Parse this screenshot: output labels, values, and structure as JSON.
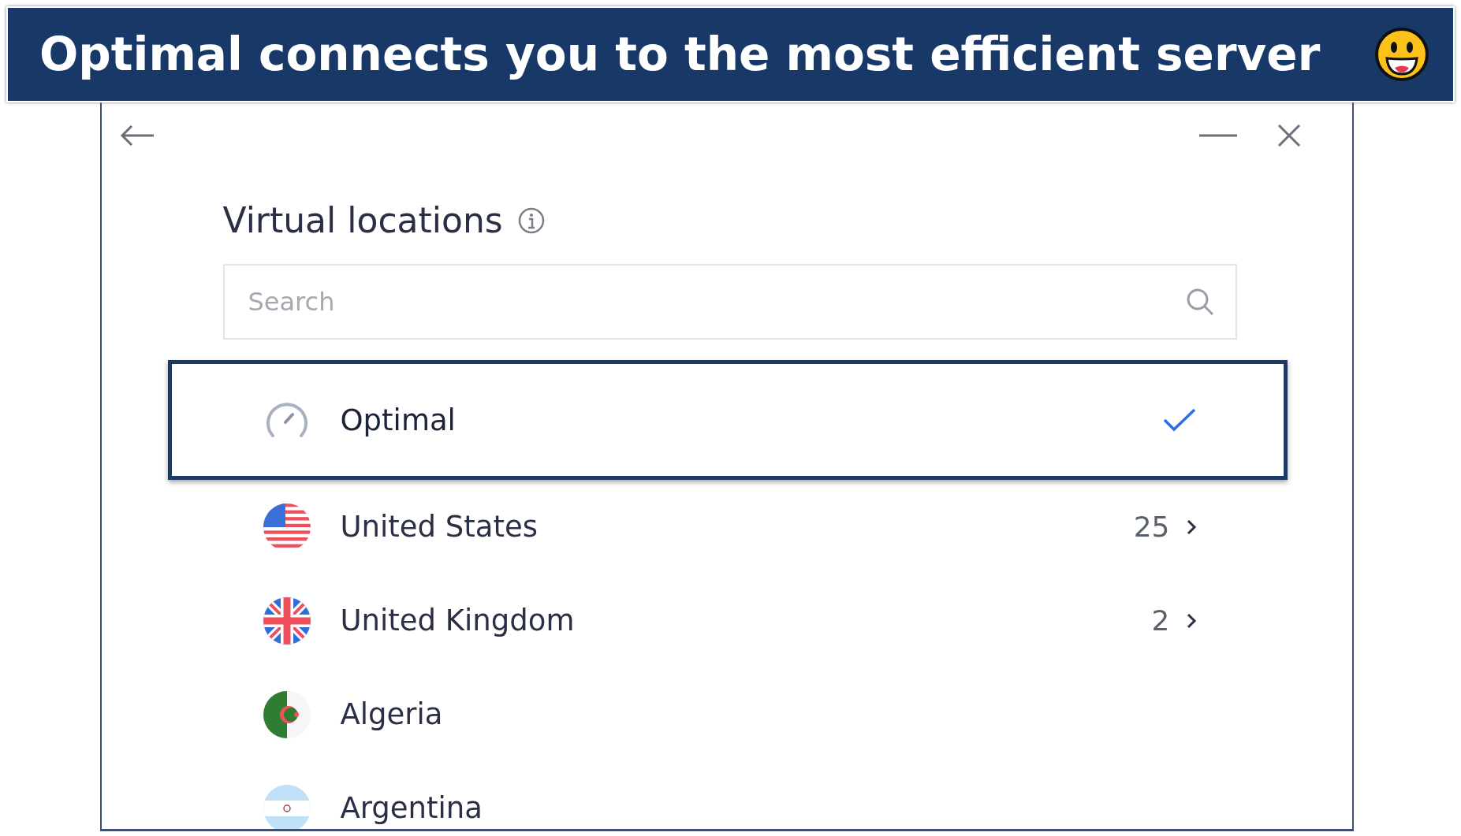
{
  "banner": {
    "text": "Optimal connects you to the most efficient server"
  },
  "title": "Virtual locations",
  "search": {
    "placeholder": "Search"
  },
  "locations": [
    {
      "name": "Optimal",
      "kind": "speedometer",
      "selected": true,
      "highlighted": true
    },
    {
      "name": "United States",
      "kind": "us",
      "count": "25",
      "selected": false,
      "highlighted": false
    },
    {
      "name": "United Kingdom",
      "kind": "uk",
      "count": "2",
      "selected": false,
      "highlighted": false
    },
    {
      "name": "Algeria",
      "kind": "dz",
      "selected": false,
      "highlighted": false
    },
    {
      "name": "Argentina",
      "kind": "ar",
      "selected": false,
      "highlighted": false
    }
  ]
}
